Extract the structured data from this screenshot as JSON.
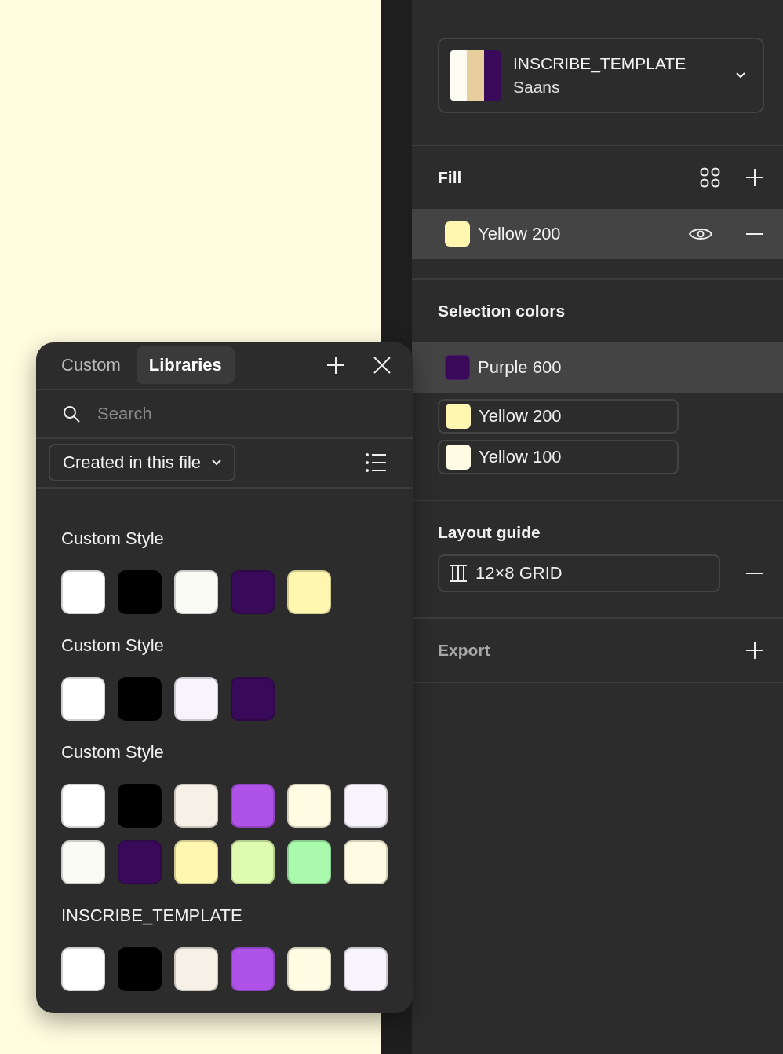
{
  "template": {
    "name": "INSCRIBE_TEMPLATE",
    "font": "Saans",
    "stripes": [
      {
        "color": "#fdfcf3"
      },
      {
        "color": "#e6cf9c"
      },
      {
        "color": "#3a0a5a"
      }
    ]
  },
  "fill": {
    "title": "Fill",
    "items": [
      {
        "name": "Yellow 200",
        "color": "#fff7b0"
      }
    ]
  },
  "selection_colors": {
    "title": "Selection colors",
    "items": [
      {
        "name": "Purple 600",
        "color": "#3a0a5a",
        "selected": true
      },
      {
        "name": "Yellow 200",
        "color": "#fff7b0",
        "selected": false
      },
      {
        "name": "Yellow 100",
        "color": "#fffce3",
        "selected": false
      }
    ]
  },
  "layout_guide": {
    "title": "Layout guide",
    "items": [
      {
        "name": "12×8 GRID"
      }
    ]
  },
  "export": {
    "title": "Export"
  },
  "popup": {
    "tabs": [
      {
        "label": "Custom",
        "selected": false
      },
      {
        "label": "Libraries",
        "selected": true
      }
    ],
    "search": {
      "placeholder": "Search"
    },
    "filter": {
      "value": "Created in this file"
    },
    "groups": [
      {
        "title": "Custom Style",
        "swatches": [
          {
            "color": "#ffffff"
          },
          {
            "color": "#000000"
          },
          {
            "color": "#fbfbf5"
          },
          {
            "color": "#3a0a5a"
          },
          {
            "color": "#fff7b0"
          }
        ]
      },
      {
        "title": "Custom Style",
        "swatches": [
          {
            "color": "#ffffff"
          },
          {
            "color": "#000000"
          },
          {
            "color": "#f8f4fb"
          },
          {
            "color": "#3a0a5a"
          }
        ]
      },
      {
        "title": "Custom Style",
        "swatches": [
          {
            "color": "#ffffff"
          },
          {
            "color": "#000000"
          },
          {
            "color": "#f7f0e6"
          },
          {
            "color": "#ae52e8"
          },
          {
            "color": "#fffce3"
          },
          {
            "color": "#f8f4fb"
          },
          {
            "color": "#fbfbf5"
          },
          {
            "color": "#3a0a5a"
          },
          {
            "color": "#fff7b0"
          },
          {
            "color": "#dffbb0"
          },
          {
            "color": "#aafaae"
          },
          {
            "color": "#fffce3"
          }
        ]
      },
      {
        "title": "INSCRIBE_TEMPLATE",
        "swatches": [
          {
            "color": "#ffffff"
          },
          {
            "color": "#000000"
          },
          {
            "color": "#f7f0e6"
          },
          {
            "color": "#ae52e8"
          },
          {
            "color": "#fffce3"
          },
          {
            "color": "#f8f4fb"
          }
        ]
      }
    ]
  }
}
